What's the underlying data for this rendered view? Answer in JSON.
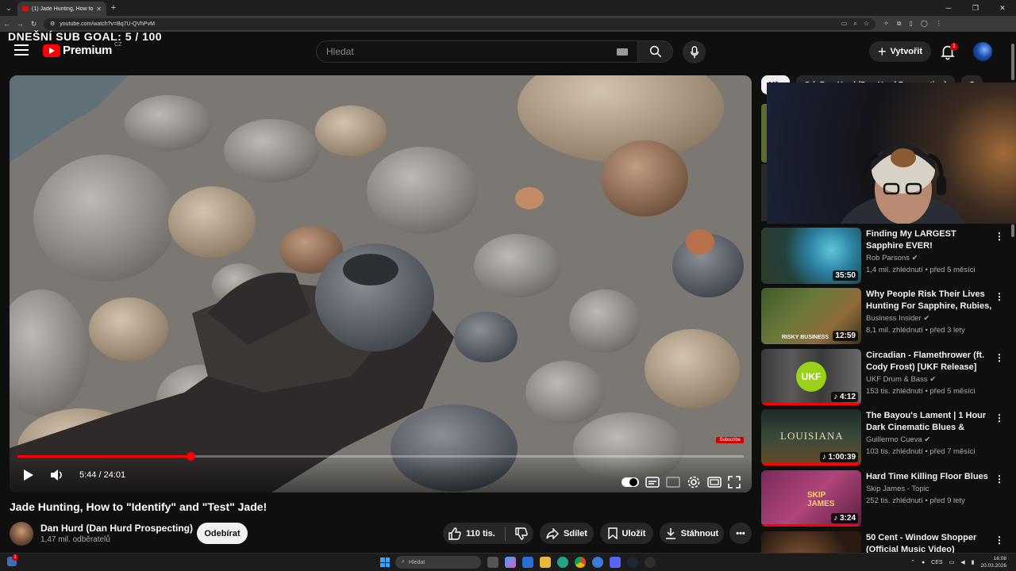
{
  "browser": {
    "tab_title": "(1) Jade Hunting, How to \"Iden",
    "url": "youtube.com/watch?v=Bq7U-QVhPvM"
  },
  "overlay": {
    "sub_goal": "DNEŠNÍ SUB GOAL: 5 / 100"
  },
  "header": {
    "logo_text": "Premium",
    "country_code": "CZ",
    "search_placeholder": "Hledat",
    "create_label": "Vytvořit",
    "notification_count": "1"
  },
  "player": {
    "progress_fraction": 0.238,
    "time_display": "5:44 / 24:01",
    "watermark": "Subscribe"
  },
  "video": {
    "title": "Jade Hunting, How to \"Identify\" and \"Test\" Jade!",
    "channel_name": "Dan Hurd (Dan Hurd Prospecting)",
    "channel_subs": "1,47 mil. odběratelů",
    "subscribe_label": "Odebírat",
    "like_count": "110 tis.",
    "share_label": "Sdílet",
    "save_label": "Uložit",
    "download_label": "Stáhnout"
  },
  "sidebar": {
    "chips": [
      "Vše",
      "Od: Dan Hurd (Dan Hurd Prospecting)",
      "S"
    ],
    "recommendations": [
      {
        "title": "Finding My LARGEST Sapphire EVER!",
        "channel": "Rob Parsons",
        "meta": "1,4 mil. zhlédnutí • před 5 měsíci",
        "duration": "35:50",
        "thumb_label": ""
      },
      {
        "title": "Why People Risk Their Lives Hunting For Sapphire, Rubies, ...",
        "channel": "Business Insider",
        "meta": "8,1 mil. zhlédnutí • před 3 lety",
        "duration": "12:59",
        "thumb_label": "RISKY BUSINESS"
      },
      {
        "title": "Circadian - Flamethrower (ft. Cody Frost) [UKF Release]",
        "channel": "UKF Drum & Bass",
        "meta": "153 tis. zhlédnutí • před 5 měsíci",
        "duration": "4:12",
        "thumb_label": "UKF"
      },
      {
        "title": "The Bayou's Lament | 1 Hour Dark Cinematic Blues & Swam...",
        "channel": "Guillermo Cueva",
        "meta": "103 tis. zhlédnutí • před 7 měsíci",
        "duration": "1:00:39",
        "thumb_label": "LOUISIANA"
      },
      {
        "title": "Hard Time Killing Floor Blues",
        "channel": "Skip James - Topic",
        "meta": "252 tis. zhlédnutí • před 9 lety",
        "duration": "3:24",
        "thumb_label": "SKIP JAMES"
      },
      {
        "title": "50 Cent - Window Shopper (Official Music Video)",
        "channel": "",
        "meta": "",
        "duration": "",
        "thumb_label": ""
      }
    ]
  },
  "taskbar": {
    "notification_badge": "1",
    "search_placeholder": "Hledat",
    "language": "CES",
    "time": "16:08",
    "date": "20.03.2026"
  },
  "colors": {
    "accent": "#ff0000",
    "background": "#0f0f0f",
    "pill": "#272727"
  }
}
